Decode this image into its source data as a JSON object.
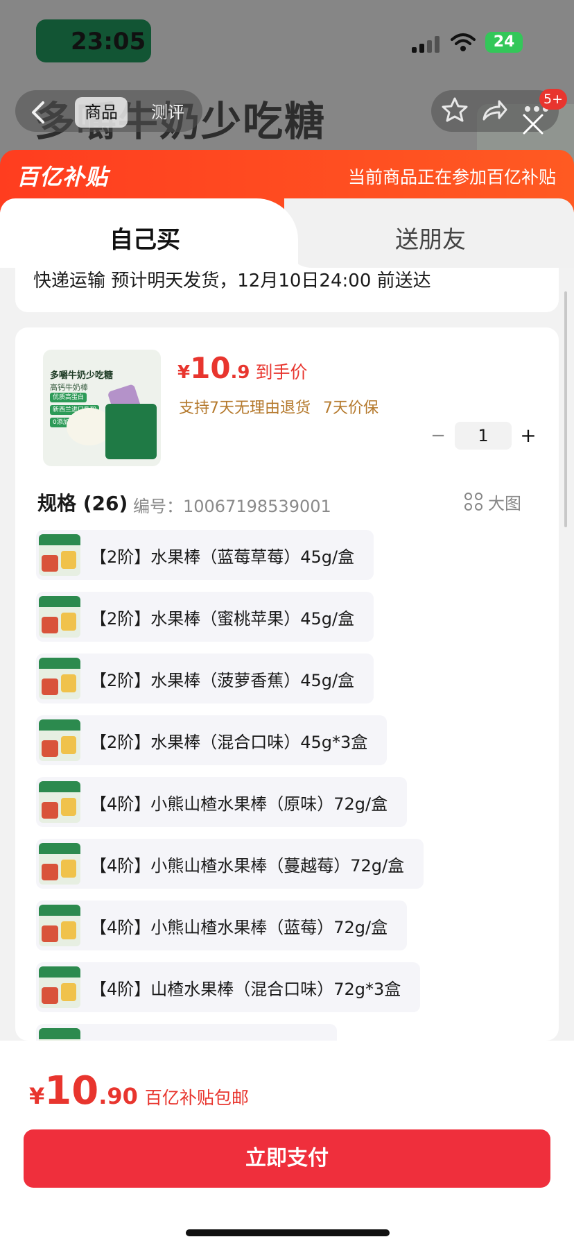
{
  "status_bar": {
    "time": "23:05",
    "battery": "24"
  },
  "background_page": {
    "title": "多嚼牛奶少吃糖",
    "tabs": [
      "商品",
      "测评"
    ],
    "notification_count": "5+"
  },
  "subsidy_banner": {
    "logo": "百亿补贴",
    "note": "当前商品正在参加百亿补贴"
  },
  "purchase_tabs": {
    "self": "自己买",
    "gift": "送朋友"
  },
  "delivery": {
    "text": "快递运输 预计明天发货，12月10日24:00 前送达"
  },
  "product": {
    "thumb_title": "多嚼牛奶少吃糖",
    "thumb_subtitle": "高钙牛奶棒",
    "thumb_tags": [
      "优质高蛋白",
      "新西兰进口乳粉",
      "0添加"
    ],
    "price_currency": "¥",
    "price_integer": "10",
    "price_decimal": ".9",
    "price_label": "到手价",
    "guarantees": [
      "支持7天无理由退货",
      "7天价保"
    ],
    "quantity": "1",
    "qty_minus": "−",
    "qty_plus": "+"
  },
  "spec": {
    "heading": "规格 (26)",
    "code": "编号：10067198539001",
    "big_view": "大图",
    "items": [
      "【2阶】水果棒（蓝莓草莓）45g/盒",
      "【2阶】水果棒（蜜桃苹果）45g/盒",
      "【2阶】水果棒（菠萝香蕉）45g/盒",
      "【2阶】水果棒（混合口味）45g*3盒",
      "【4阶】小熊山楂水果棒（原味）72g/盒",
      "【4阶】小熊山楂水果棒（蔓越莓）72g/盒",
      "【4阶】小熊山楂水果棒（蓝莓）72g/盒",
      "【4阶】山楂水果棒（混合口味）72g*3盒"
    ]
  },
  "footer": {
    "currency": "¥",
    "total_integer": "10",
    "total_decimal": ".90",
    "note": "百亿补贴包邮",
    "pay_label": "立即支付"
  },
  "colors": {
    "accent": "#e8352e",
    "subsidy": "#ff4a1f",
    "pay_button": "#ef2f3c",
    "guarantee": "#b57a2e"
  }
}
